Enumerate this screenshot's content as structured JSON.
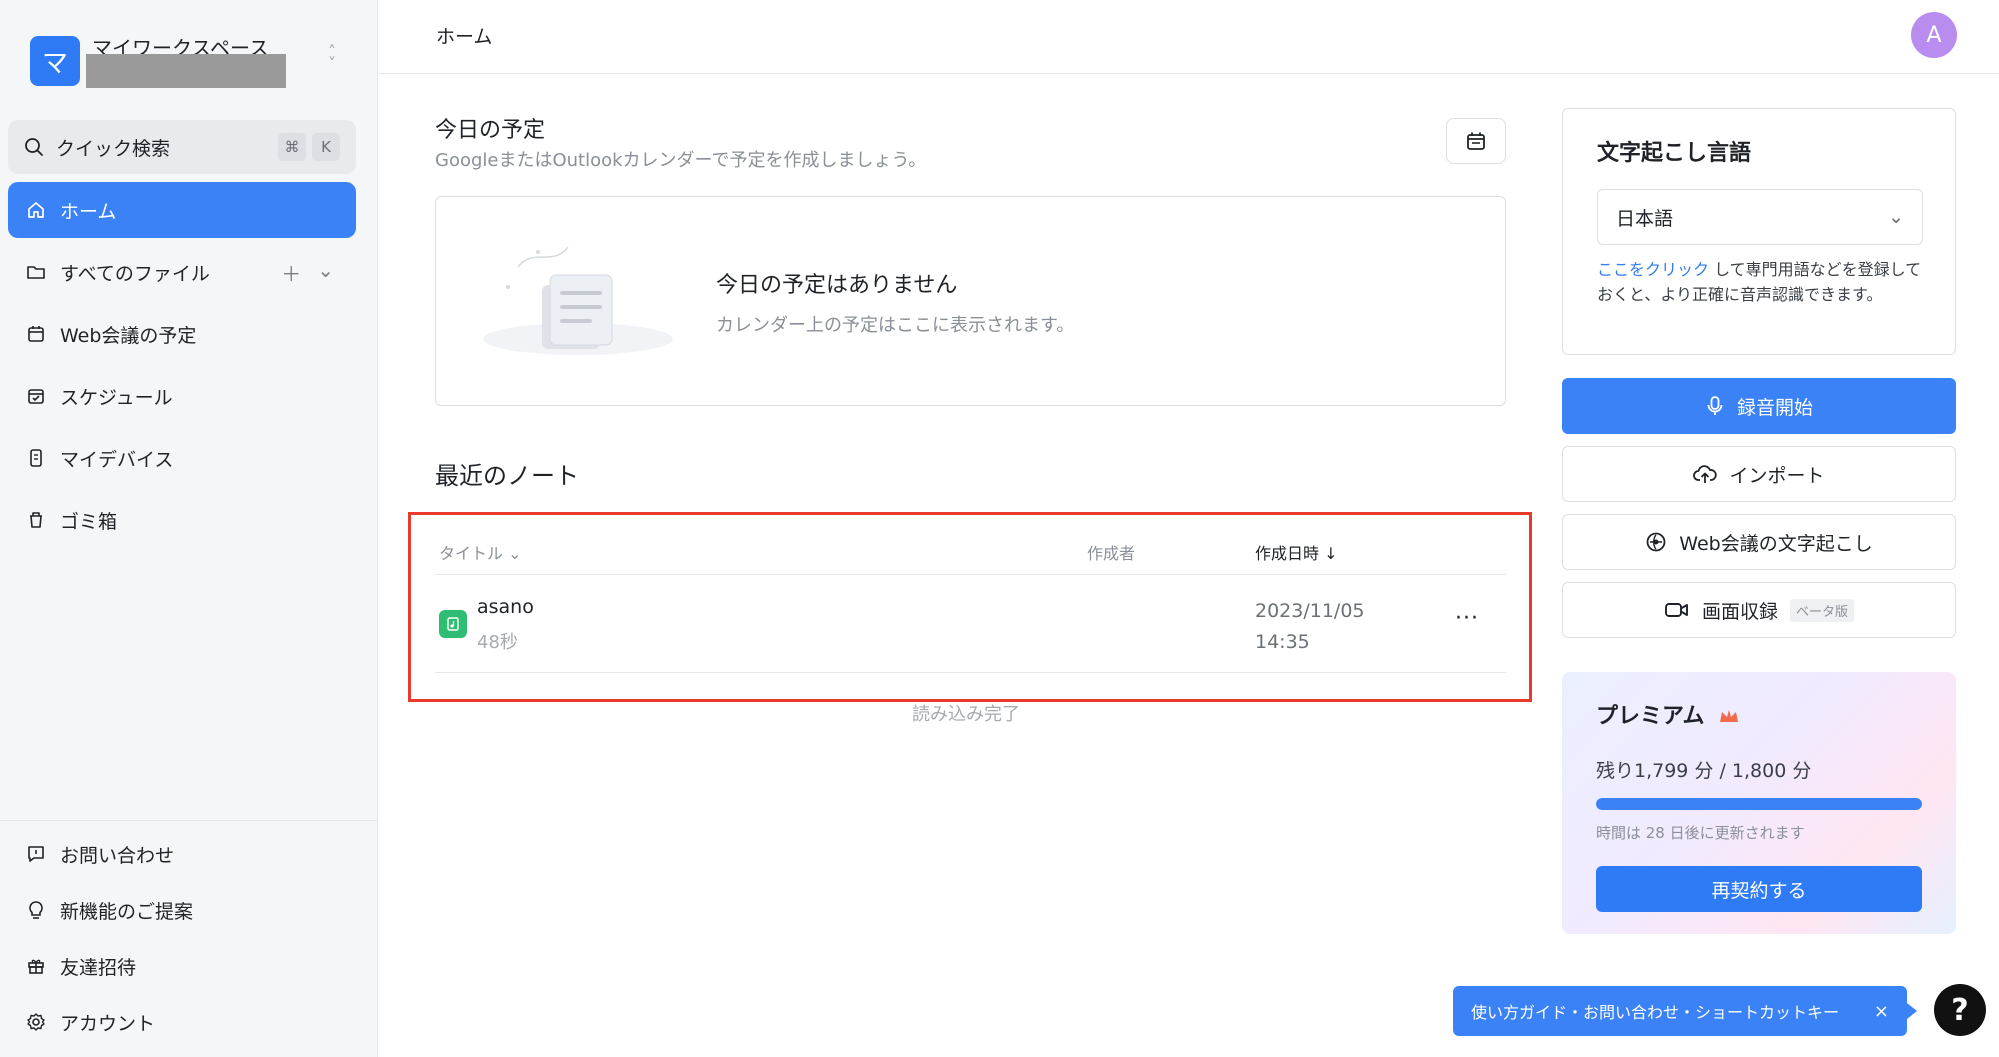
{
  "workspace": {
    "avatar_letter": "マ",
    "name": "マイワークスペース"
  },
  "search": {
    "label": "クイック検索",
    "shortcut_cmd": "⌘",
    "shortcut_key": "K"
  },
  "nav": {
    "items": [
      {
        "label": "ホーム",
        "icon": "home-icon"
      },
      {
        "label": "すべてのファイル",
        "icon": "folder-icon"
      },
      {
        "label": "Web会議の予定",
        "icon": "calendar-icon"
      },
      {
        "label": "スケジュール",
        "icon": "schedule-icon"
      },
      {
        "label": "マイデバイス",
        "icon": "device-icon"
      },
      {
        "label": "ゴミ箱",
        "icon": "trash-icon"
      }
    ],
    "bottom": [
      {
        "label": "お問い合わせ",
        "icon": "message-icon"
      },
      {
        "label": "新機能のご提案",
        "icon": "lightbulb-icon"
      },
      {
        "label": "友達招待",
        "icon": "gift-icon"
      },
      {
        "label": "アカウント",
        "icon": "settings-icon"
      }
    ]
  },
  "header": {
    "breadcrumb": "ホーム",
    "user_initial": "A"
  },
  "schedule": {
    "title": "今日の予定",
    "subtitle": "GoogleまたはOutlookカレンダーで予定を作成しましょう。",
    "empty_title": "今日の予定はありません",
    "empty_subtitle": "カレンダー上の予定はここに表示されます。"
  },
  "recent": {
    "title": "最近のノート",
    "columns": {
      "title": "タイトル",
      "creator": "作成者",
      "created": "作成日時"
    },
    "rows": [
      {
        "title": "asano",
        "duration": "48秒",
        "date": "2023/11/05",
        "time": "14:35"
      }
    ],
    "load_status": "読み込み完了"
  },
  "language": {
    "title": "文字起こし言語",
    "selected": "日本語",
    "help_link": "ここをクリック",
    "help_text": " して専門用語などを登録しておくと、より正確に音声認識できます。"
  },
  "actions": {
    "record": "録音開始",
    "import": "インポート",
    "web_meeting": "Web会議の文字起こし",
    "screen_record": "画面収録",
    "beta": "ベータ版"
  },
  "premium": {
    "title": "プレミアム",
    "remaining": "残り1,799 分 / 1,800 分",
    "progress": 0.9994,
    "renew_note": "時間は 28 日後に更新されます",
    "button": "再契約する"
  },
  "help": {
    "banner": "使い方ガイド・お問い合わせ・ショートカットキー",
    "close": "×",
    "question": "?"
  },
  "colors": {
    "accent": "#3b82f6",
    "highlight": "#e8392b",
    "success": "#2dbd73"
  }
}
